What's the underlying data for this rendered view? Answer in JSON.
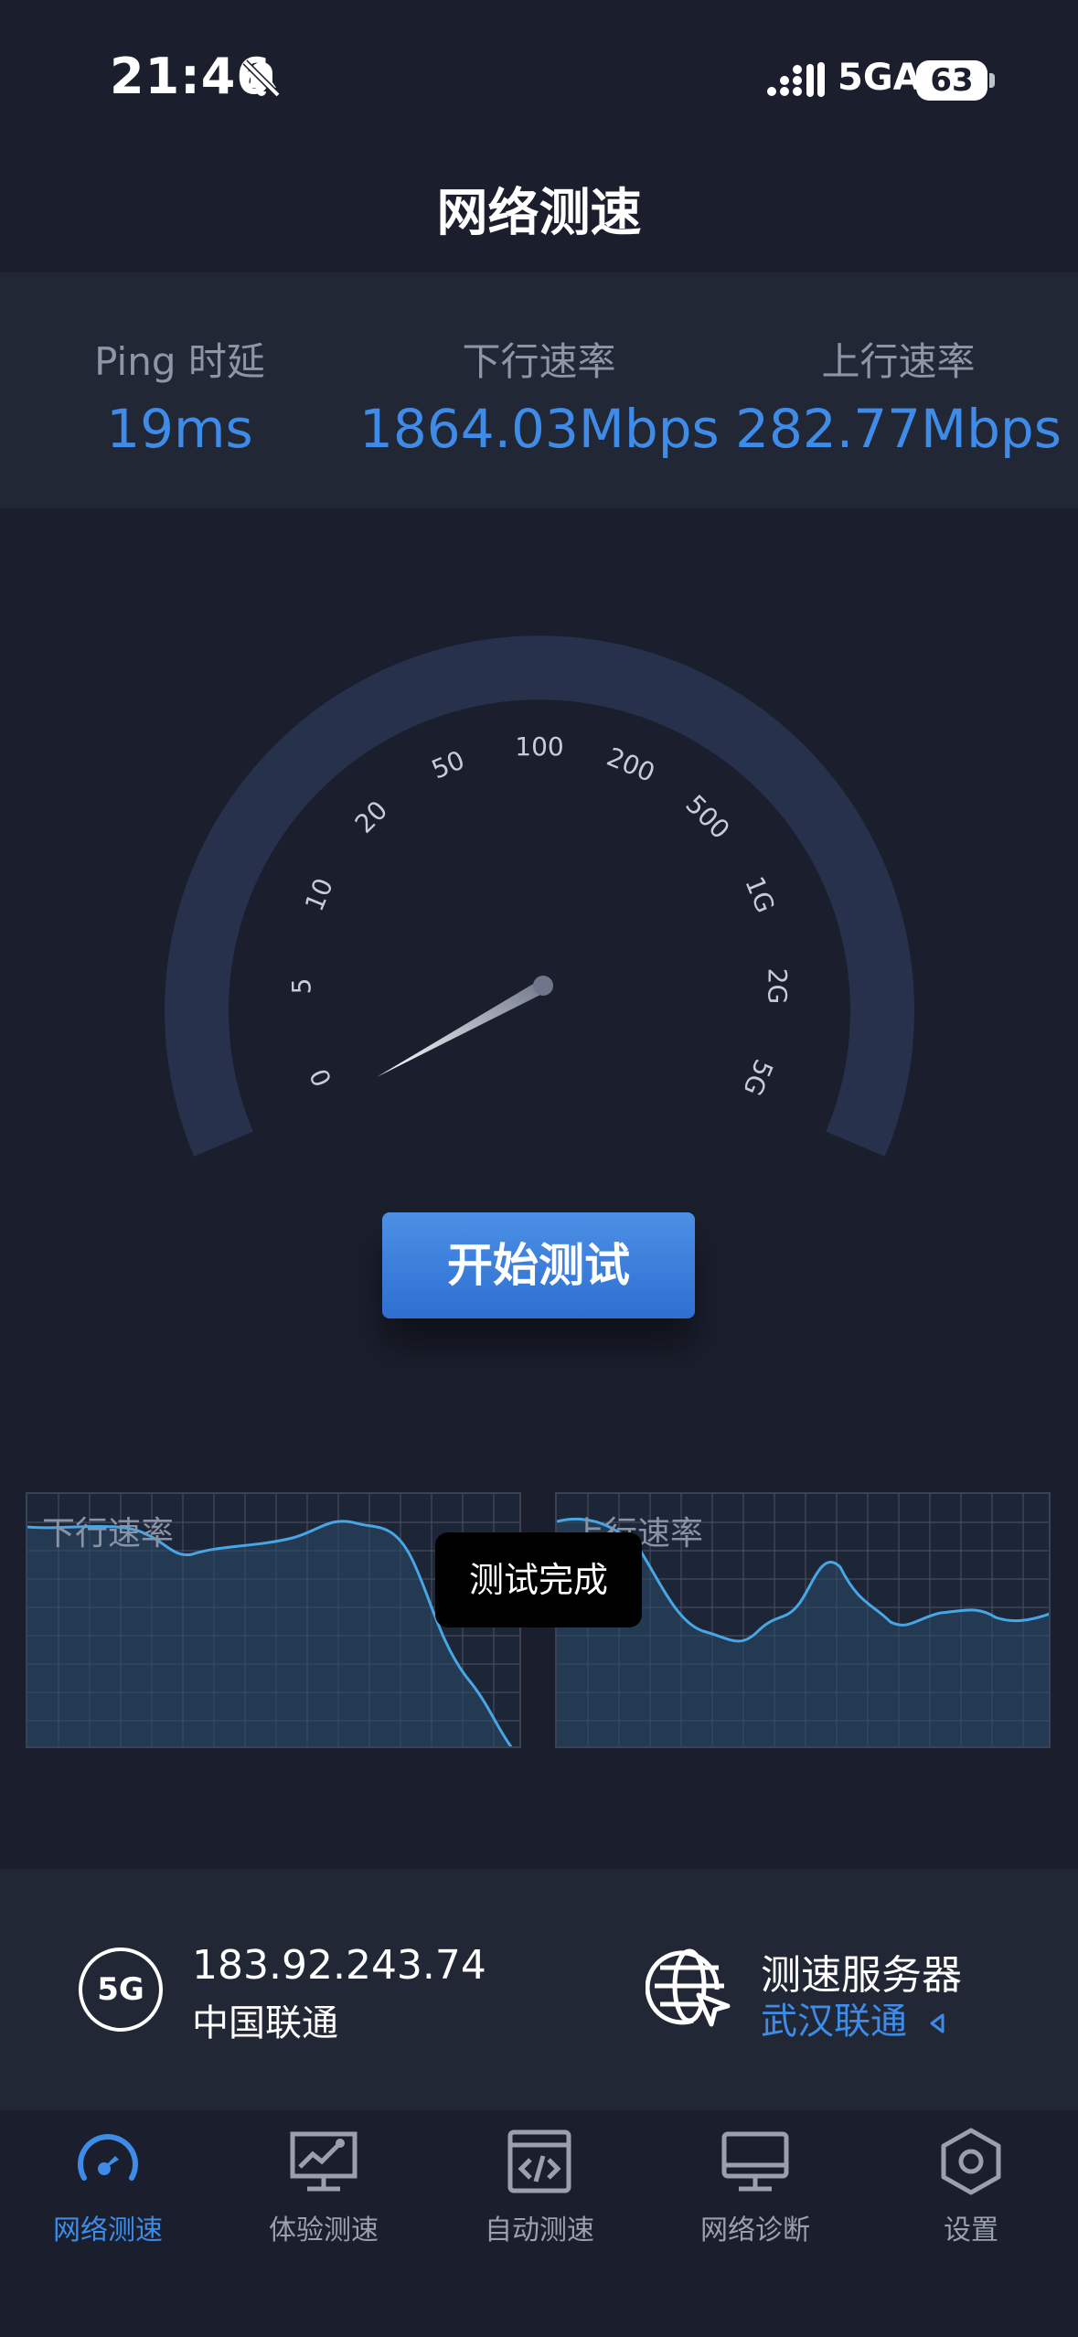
{
  "status_bar": {
    "time": "21:46",
    "network": "5GA",
    "battery": "63",
    "icons": [
      "bell-muted-icon",
      "signal-icon",
      "battery-icon"
    ]
  },
  "header": {
    "title": "网络测速"
  },
  "stats": {
    "ping_label": "Ping 时延",
    "ping_value": "19ms",
    "down_label": "下行速率",
    "down_value": "1864.03Mbps",
    "up_label": "上行速率",
    "up_value": "282.77Mbps"
  },
  "gauge": {
    "ticks": [
      "0",
      "5",
      "10",
      "20",
      "50",
      "100",
      "200",
      "500",
      "1G",
      "2G",
      "5G"
    ],
    "needle_value": "0"
  },
  "start_button": {
    "label": "开始测试"
  },
  "mini_charts": {
    "download_label": "下行速率",
    "upload_label": "上行速率"
  },
  "toast": {
    "text": "测试完成"
  },
  "info": {
    "network_badge": "5G",
    "ip": "183.92.243.74",
    "isp": "中国联通",
    "server_label": "测速服务器",
    "server_name": "武汉联通"
  },
  "tabs": [
    {
      "label": "网络测速",
      "icon": "speedometer-icon",
      "active": true
    },
    {
      "label": "体验测速",
      "icon": "chart-monitor-icon",
      "active": false
    },
    {
      "label": "自动测速",
      "icon": "code-window-icon",
      "active": false
    },
    {
      "label": "网络诊断",
      "icon": "monitor-icon",
      "active": false
    },
    {
      "label": "设置",
      "icon": "hexagon-gear-icon",
      "active": false
    }
  ],
  "colors": {
    "background": "#1b1f2d",
    "panel": "#222736",
    "accent": "#3e8ce8",
    "gauge_arc": "#27314c"
  }
}
